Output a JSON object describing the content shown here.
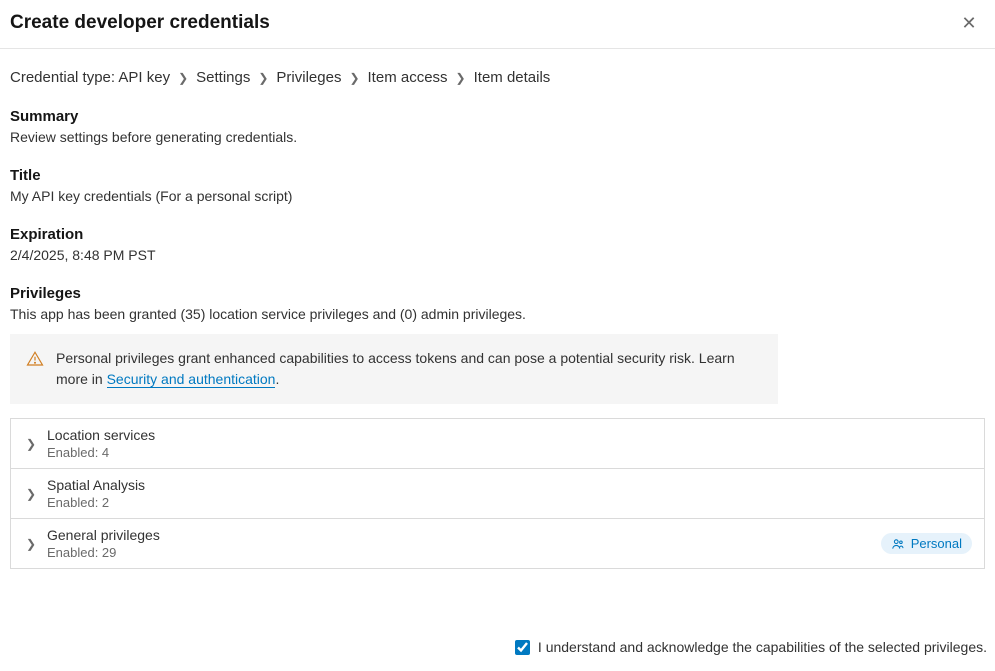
{
  "header": {
    "title": "Create developer credentials"
  },
  "breadcrumb": {
    "items": [
      "Credential type: API key",
      "Settings",
      "Privileges",
      "Item access",
      "Item details"
    ]
  },
  "summary": {
    "heading": "Summary",
    "text": "Review settings before generating credentials."
  },
  "title_section": {
    "heading": "Title",
    "text": "My API key credentials (For a personal script)"
  },
  "expiration": {
    "heading": "Expiration",
    "text": "2/4/2025, 8:48 PM PST"
  },
  "privileges": {
    "heading": "Privileges",
    "text": "This app has been granted (35) location service privileges and (0) admin privileges."
  },
  "notice": {
    "text_before": "Personal privileges grant enhanced capabilities to access tokens and can pose a potential security risk. Learn more in ",
    "link": "Security and authentication",
    "text_after": "."
  },
  "accordion": {
    "items": [
      {
        "title": "Location services",
        "sub": "Enabled: 4",
        "badge": null
      },
      {
        "title": "Spatial Analysis",
        "sub": "Enabled: 2",
        "badge": null
      },
      {
        "title": "General privileges",
        "sub": "Enabled: 29",
        "badge": "Personal"
      }
    ]
  },
  "footer": {
    "checked": true,
    "label": "I understand and acknowledge the capabilities of the selected privileges."
  }
}
